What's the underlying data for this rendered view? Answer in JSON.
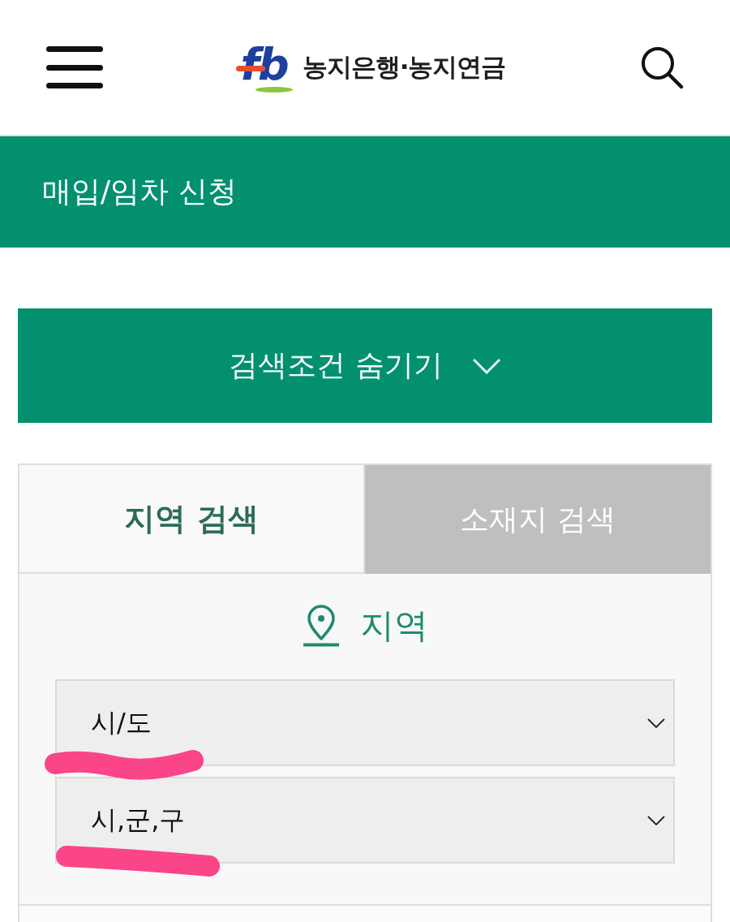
{
  "header": {
    "logo": {
      "mark": "fb",
      "name": "농지은행·농지연금"
    }
  },
  "page_title": "매입/임차 신청",
  "toggle_button": {
    "label": "검색조건 숨기기",
    "expanded": true
  },
  "tabs": [
    {
      "label": "지역 검색",
      "selected": true
    },
    {
      "label": "소재지 검색",
      "selected": false
    }
  ],
  "region": {
    "heading": "지역",
    "selects": [
      {
        "placeholder": "시/도",
        "highlighted": true
      },
      {
        "placeholder": "시,군,구",
        "highlighted": true
      }
    ]
  }
}
